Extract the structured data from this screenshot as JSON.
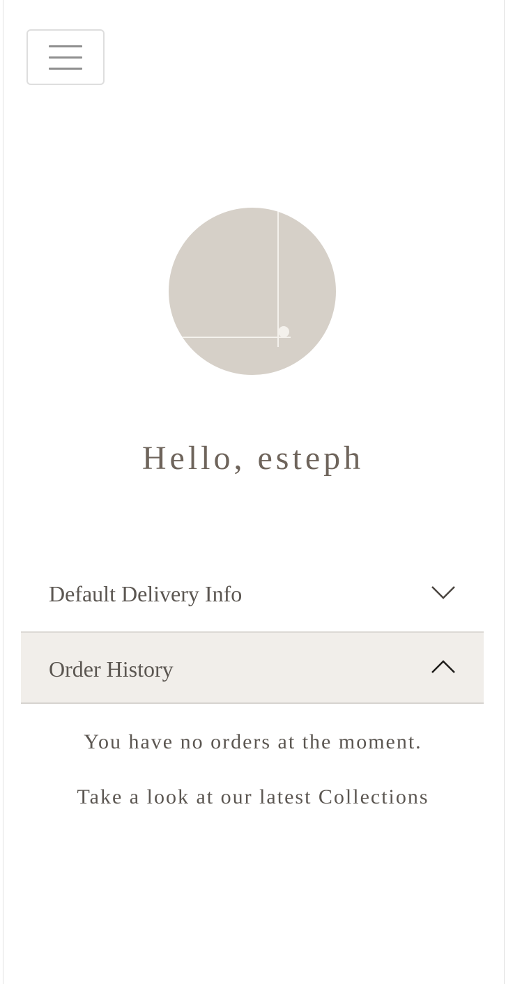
{
  "header": {
    "menu_icon": "hamburger-menu-icon"
  },
  "profile": {
    "avatar_color": "#d6d0c8",
    "greeting": "Hello, esteph"
  },
  "accordion": {
    "items": [
      {
        "label": "Default Delivery Info",
        "icon": "chevron-down-icon",
        "expanded": false
      },
      {
        "label": "Order History",
        "icon": "chevron-up-icon",
        "expanded": true
      }
    ]
  },
  "order_history": {
    "empty_message": "You have no orders at the moment.",
    "collections_link": "Take a look at our latest Collections"
  },
  "colors": {
    "text": "#5b5651",
    "heading": "#6e645b",
    "active_row": "#f1eeea"
  }
}
